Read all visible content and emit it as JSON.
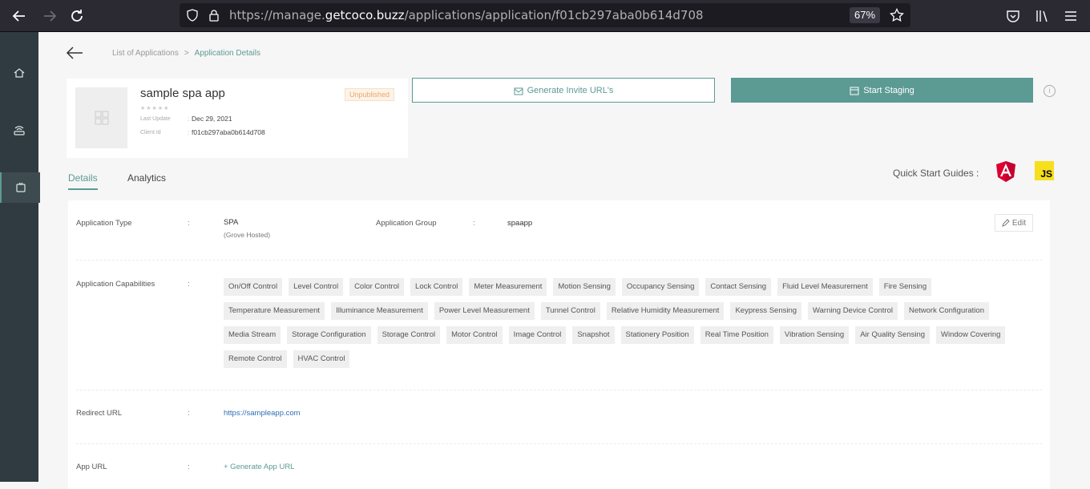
{
  "browser": {
    "url_prefix": "https://manage.",
    "url_domain": "getcoco.buzz",
    "url_path": "/applications/application/f01cb297aba0b614d708",
    "zoom": "67%"
  },
  "breadcrumb": {
    "parent": "List of Applications",
    "separator": ">",
    "current": "Application Details"
  },
  "app": {
    "name": "sample spa app",
    "stars": "★★★★★",
    "status": "Unpublished",
    "last_update_label": "Last Update",
    "last_update_value": "Dec 29, 2021",
    "client_id_label": "Client Id",
    "client_id_value": "f01cb297aba0b614d708",
    "colon": ":"
  },
  "actions": {
    "invite": "Generate Invite URL's",
    "staging": "Start Staging"
  },
  "tabs": {
    "details": "Details",
    "analytics": "Analytics"
  },
  "quick_start": {
    "label": "Quick Start Guides :",
    "js": "JS"
  },
  "details": {
    "type_label": "Application Type",
    "type_value": "SPA",
    "type_sub": "(Grove Hosted)",
    "group_label": "Application Group",
    "group_value": "spaapp",
    "edit": "Edit",
    "capabilities_label": "Application Capabilities",
    "capabilities": [
      "On/Off Control",
      "Level Control",
      "Color Control",
      "Lock Control",
      "Meter Measurement",
      "Motion Sensing",
      "Occupancy Sensing",
      "Contact Sensing",
      "Fluid Level Measurement",
      "Fire Sensing",
      "Temperature Measurement",
      "Illuminance Measurement",
      "Power Level Measurement",
      "Tunnel Control",
      "Relative Humidity Measurement",
      "Keypress Sensing",
      "Warning Device Control",
      "Network Configuration",
      "Media Stream",
      "Storage Configuration",
      "Storage Control",
      "Motor Control",
      "Image Control",
      "Snapshot",
      "Stationery Position",
      "Real Time Position",
      "Vibration Sensing",
      "Air Quality Sensing",
      "Window Covering",
      "Remote Control",
      "HVAC Control"
    ],
    "redirect_label": "Redirect URL",
    "redirect_value": "https://sampleapp.com",
    "app_url_label": "App URL",
    "app_url_action": "+ Generate App URL",
    "colon": ":"
  },
  "colors": {
    "accent": "#5c9a94",
    "sidebar": "#2f3b40",
    "badge_text": "#e8a86b",
    "link": "#2f6fb7"
  }
}
